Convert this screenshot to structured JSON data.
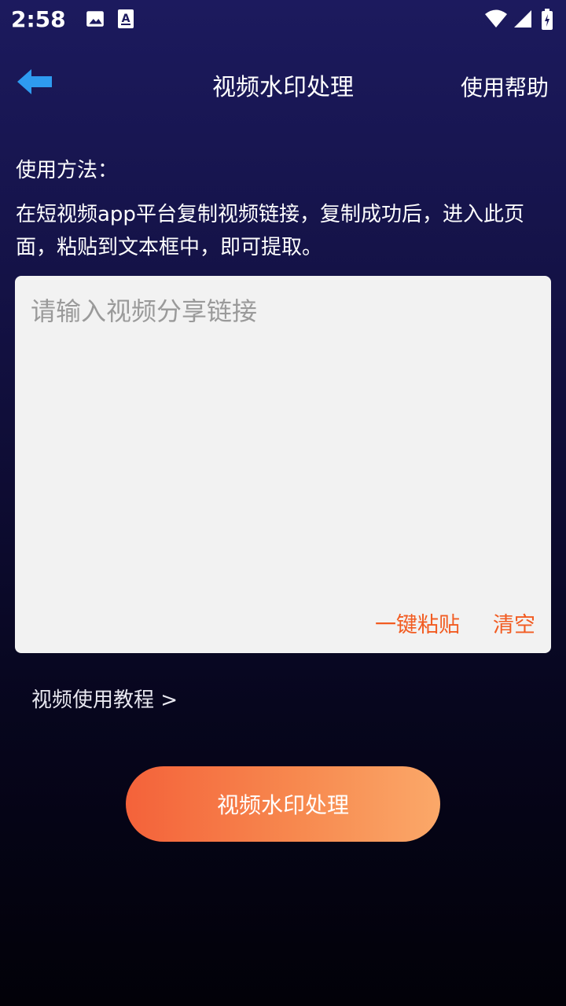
{
  "status_bar": {
    "time": "2:58",
    "left_icons": [
      "image-icon",
      "font-download-icon"
    ],
    "right_icons": [
      "wifi-icon",
      "signal-icon",
      "battery-icon"
    ]
  },
  "header": {
    "back_icon": "arrow-left-icon",
    "title": "视频水印处理",
    "help_label": "使用帮助"
  },
  "instructions": {
    "label": "使用方法：",
    "description": "在短视频app平台复制视频链接，复制成功后，进入此页面，粘贴到文本框中，即可提取。"
  },
  "input": {
    "value": "",
    "placeholder": "请输入视频分享链接",
    "paste_label": "一键粘贴",
    "clear_label": "清空"
  },
  "tutorial_link": "视频使用教程 >",
  "process_button": "视频水印处理",
  "colors": {
    "accent": "#f25c22",
    "back_arrow": "#2e9bf0",
    "button_gradient_start": "#f4623a",
    "button_gradient_end": "#fba869",
    "background_top": "#1c1a5e",
    "background_bottom": "#020108"
  }
}
